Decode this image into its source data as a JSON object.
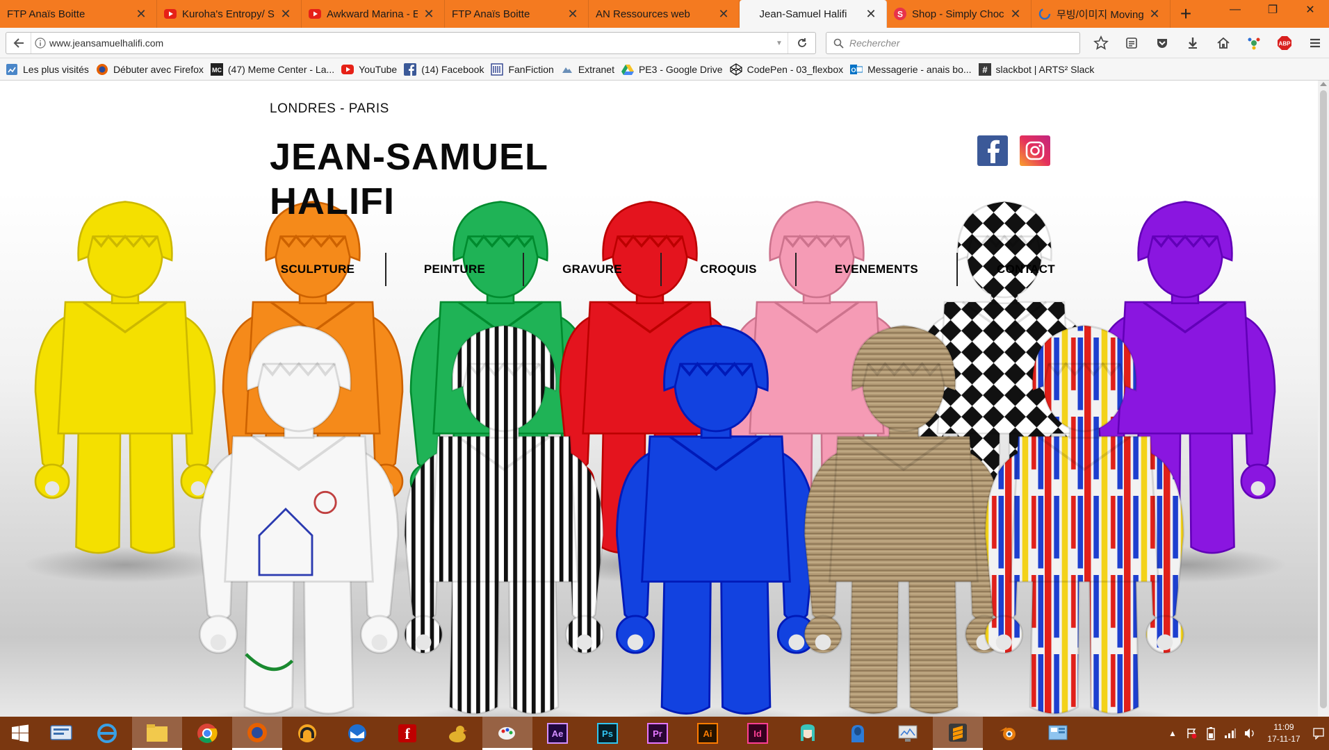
{
  "browser": {
    "tabs": [
      {
        "title": "FTP Anaïs Boitte",
        "icon": "page-icon",
        "width": 226
      },
      {
        "title": "Kuroha's Entropy/ Si",
        "icon": "youtube-icon",
        "width": 208
      },
      {
        "title": "Awkward Marina - E",
        "icon": "youtube-icon",
        "width": 206
      },
      {
        "title": "FTP Anaïs Boitte",
        "icon": "page-icon",
        "width": 207
      },
      {
        "title": "AN Ressources web",
        "icon": "page-icon",
        "width": 217
      },
      {
        "title": "Jean-Samuel Halifi",
        "icon": "none",
        "width": 212,
        "active": true
      },
      {
        "title": "Shop - Simply Choc",
        "icon": "shop-icon",
        "width": 208
      },
      {
        "title": "무빙/이미지 Moving",
        "icon": "firefox-loading-icon",
        "width": 200
      }
    ],
    "url": "www.jeansamuelhalifi.com",
    "search_placeholder": "Rechercher",
    "bookmarks": [
      {
        "label": "Les plus visités",
        "icon": "most-visited-icon"
      },
      {
        "label": "Débuter avec Firefox",
        "icon": "firefox-icon"
      },
      {
        "label": "(47) Meme Center - La...",
        "icon": "memecenter-icon"
      },
      {
        "label": "YouTube",
        "icon": "youtube-icon"
      },
      {
        "label": "(14) Facebook",
        "icon": "facebook-icon"
      },
      {
        "label": "FanFiction",
        "icon": "fanfiction-icon"
      },
      {
        "label": "Extranet",
        "icon": "extranet-icon"
      },
      {
        "label": "PE3 - Google Drive",
        "icon": "google-drive-icon"
      },
      {
        "label": "CodePen - 03_flexbox",
        "icon": "codepen-icon"
      },
      {
        "label": "Messagerie - anais bo...",
        "icon": "outlook-icon"
      },
      {
        "label": "slackbot | ARTS² Slack",
        "icon": "slack-icon"
      }
    ]
  },
  "site": {
    "location": "LONDRES - PARIS",
    "title_line1": "JEAN-SAMUEL",
    "title_line2": "HALIFI",
    "nav": [
      "SCULPTURE",
      "PEINTURE",
      "GRAVURE",
      "CROQUIS",
      "EVENEMENTS",
      "CONTACT"
    ],
    "colors": {
      "facebook": "#3b5998",
      "instagram": "#e4305c"
    }
  },
  "hero_figures": [
    {
      "color": "#f4e000",
      "row": "back"
    },
    {
      "color": "#f58a1a",
      "row": "back"
    },
    {
      "color": "#1fb356",
      "row": "back"
    },
    {
      "color": "#e4141e",
      "row": "back"
    },
    {
      "color": "#f59bb5",
      "row": "back"
    },
    {
      "color": "harlequin",
      "row": "back"
    },
    {
      "color": "#8a16e0",
      "row": "back"
    },
    {
      "color": "white-drawing",
      "row": "front"
    },
    {
      "color": "stripes",
      "row": "front"
    },
    {
      "color": "#1242e0",
      "row": "front"
    },
    {
      "color": "wood",
      "row": "front"
    },
    {
      "color": "paint-drip",
      "row": "front"
    }
  ],
  "taskbar": {
    "clock_time": "11:09",
    "clock_date": "17-11-17",
    "apps": [
      "ie",
      "explorer",
      "chrome",
      "firefox",
      "winamp",
      "thunderbird",
      "filezilla",
      "duck",
      "paint",
      "Ae",
      "Ps",
      "Pr",
      "Ai",
      "Id",
      "miku",
      "hoodie",
      "monitor",
      "sublime",
      "blender",
      "control"
    ]
  }
}
